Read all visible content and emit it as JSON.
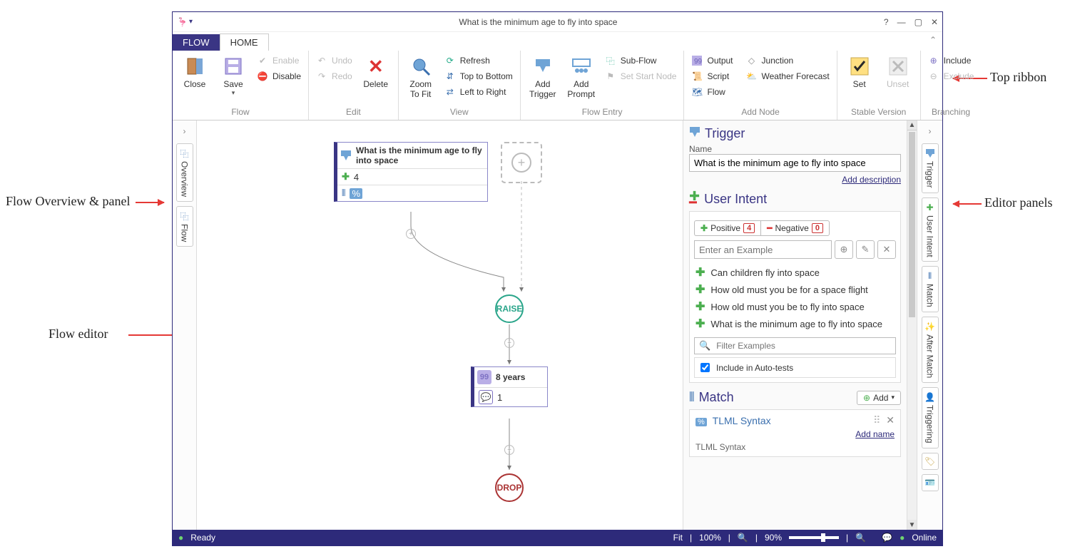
{
  "window": {
    "title": "What is the minimum age to fly into space",
    "help": "?",
    "min": "—",
    "max": "▢",
    "close": "✕"
  },
  "tabs": {
    "flow": "FLOW",
    "home": "HOME"
  },
  "ribbon": {
    "groups": {
      "flow": "Flow",
      "edit": "Edit",
      "view": "View",
      "entry": "Flow Entry",
      "addnode": "Add Node",
      "stable": "Stable Version",
      "branching": "Branching"
    },
    "close": "Close",
    "save": "Save",
    "save_arrow": "▾",
    "enable": "Enable",
    "disable": "Disable",
    "undo": "Undo",
    "redo": "Redo",
    "delete": "Delete",
    "zoom": "Zoom To Fit",
    "zoom_l1": "Zoom",
    "zoom_l2": "To Fit",
    "refresh": "Refresh",
    "ttb": "Top to Bottom",
    "ltr": "Left to Right",
    "add_trigger": "Add Trigger",
    "add_trigger_l1": "Add",
    "add_trigger_l2": "Trigger",
    "add_prompt": "Add Prompt",
    "add_prompt_l1": "Add",
    "add_prompt_l2": "Prompt",
    "subflow": "Sub-Flow",
    "setstart": "Set Start Node",
    "output": "Output",
    "script": "Script",
    "flownode": "Flow",
    "junction": "Junction",
    "weather": "Weather Forecast",
    "set": "Set",
    "unset": "Unset",
    "include": "Include",
    "exclude": "Exclude"
  },
  "left_tabs": {
    "overview": "Overview",
    "flow": "Flow"
  },
  "canvas": {
    "trigger_title": "What is the minimum age to fly into space",
    "trigger_count": "4",
    "raise": "RAISE",
    "response_text": "8 years",
    "response_count": "1",
    "drop": "DROP"
  },
  "right": {
    "trigger_heading": "Trigger",
    "name_label": "Name",
    "name_value": "What is the minimum age to fly into space",
    "add_desc": "Add description",
    "intent_heading": "User Intent",
    "positive_label": "Positive",
    "positive_count": "4",
    "negative_label": "Negative",
    "negative_count": "0",
    "example_placeholder": "Enter an Example",
    "examples": [
      "Can children fly into space",
      "How old must you be for a space flight",
      "How old must you be to fly into space",
      "What is the minimum age to fly into space"
    ],
    "filter_placeholder": "Filter Examples",
    "include_autotests": "Include in Auto-tests",
    "match_heading": "Match",
    "add_label": "Add",
    "tlml_title": "TLML Syntax",
    "add_name": "Add name",
    "tlml_footer": "TLML Syntax"
  },
  "right_tabs": {
    "trigger": "Trigger",
    "userintent": "User Intent",
    "match": "Match",
    "aftermatch": "After Match",
    "triggering": "Triggering"
  },
  "status": {
    "ready": "Ready",
    "fit": "Fit",
    "sep": "|",
    "p100": "100%",
    "p90": "90%",
    "online": "Online"
  },
  "annotations": {
    "overview": "Flow Overview & panel",
    "editor": "Flow editor",
    "topribbon": "Top ribbon",
    "editorpanels": "Editor panels"
  }
}
